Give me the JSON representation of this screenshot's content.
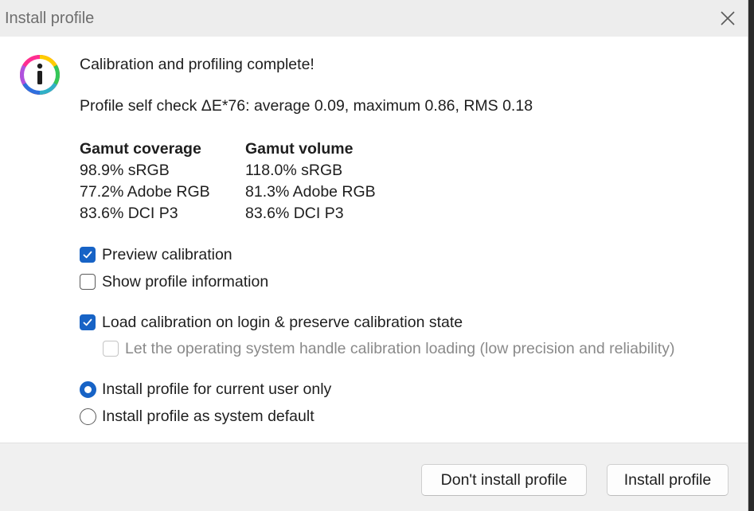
{
  "window": {
    "title": "Install profile"
  },
  "message": {
    "heading": "Calibration and profiling complete!",
    "self_check": "Profile self check ΔE*76: average 0.09, maximum 0.86, RMS 0.18"
  },
  "gamut": {
    "coverage_header": "Gamut coverage",
    "volume_header": "Gamut volume",
    "coverage": [
      "98.9% sRGB",
      "77.2% Adobe RGB",
      "83.6% DCI P3"
    ],
    "volume": [
      "118.0% sRGB",
      "81.3% Adobe RGB",
      "83.6% DCI P3"
    ]
  },
  "options": {
    "preview_calibration": {
      "label": "Preview calibration",
      "checked": true
    },
    "show_profile_info": {
      "label": "Show profile information",
      "checked": false
    },
    "load_calibration": {
      "label": "Load calibration on login & preserve calibration state",
      "checked": true
    },
    "os_handle_loading": {
      "label": "Let the operating system handle calibration loading (low precision and reliability)",
      "checked": false,
      "disabled": true
    }
  },
  "install_scope": {
    "current_user": {
      "label": "Install profile for current user only",
      "selected": true
    },
    "system_default": {
      "label": "Install profile as system default",
      "selected": false
    }
  },
  "buttons": {
    "dont_install": "Don't install profile",
    "install": "Install profile"
  },
  "colors": {
    "accent": "#1763c6",
    "footer_bg": "#f0f0f0",
    "titlebar_bg": "#ededed"
  }
}
